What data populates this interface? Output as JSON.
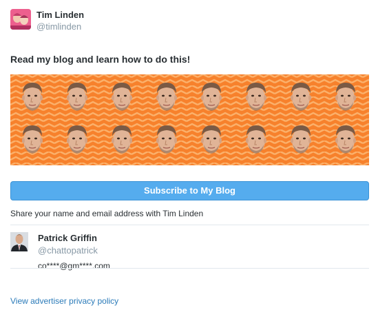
{
  "author": {
    "display_name": "Tim Linden",
    "handle": "@timlinden"
  },
  "card": {
    "headline": "Read my blog and learn how to do this!",
    "cta_label": "Subscribe to My Blog",
    "share_notice": "Share your name and email address with Tim Linden"
  },
  "viewer": {
    "display_name": "Patrick Griffin",
    "handle": "@chattopatrick",
    "email_masked": "co****@gm****.com"
  },
  "footer": {
    "privacy_link": "View advertiser privacy policy"
  },
  "colors": {
    "button": "#55acee",
    "link": "#2b7bb9",
    "muted": "#8899a6",
    "banner_orange": "#f7812c"
  }
}
